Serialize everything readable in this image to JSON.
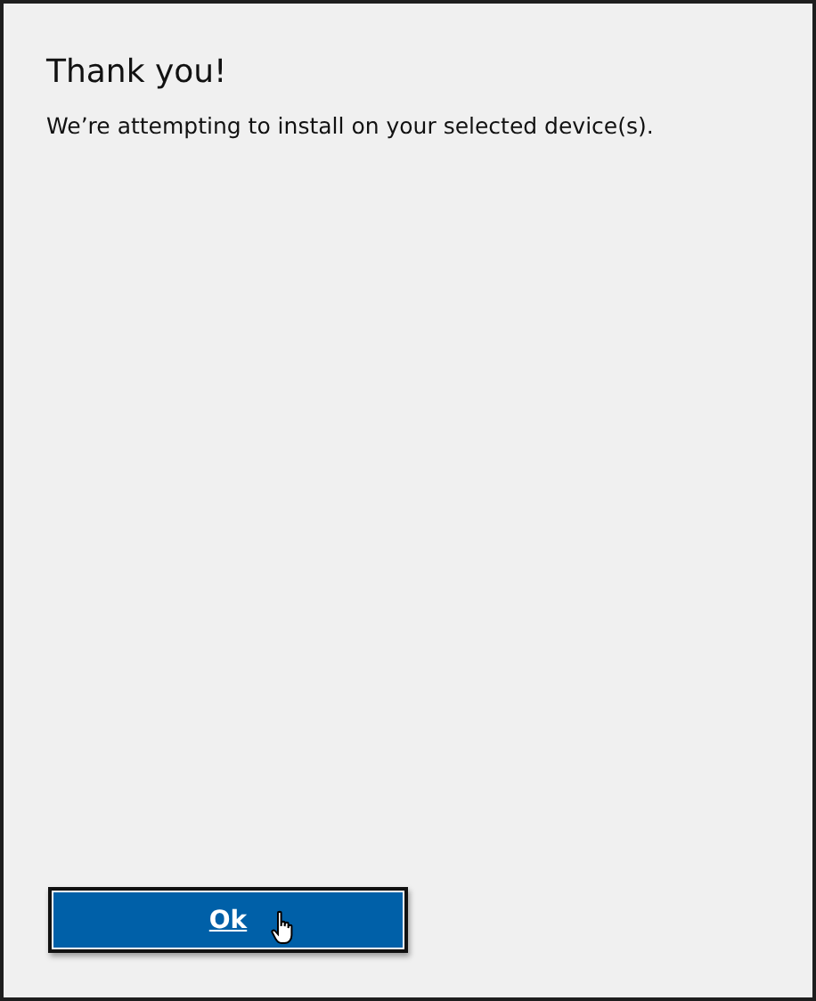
{
  "dialog": {
    "title": "Thank you!",
    "message": "We’re attempting to install on your selected device(s).",
    "button": "Ok"
  }
}
